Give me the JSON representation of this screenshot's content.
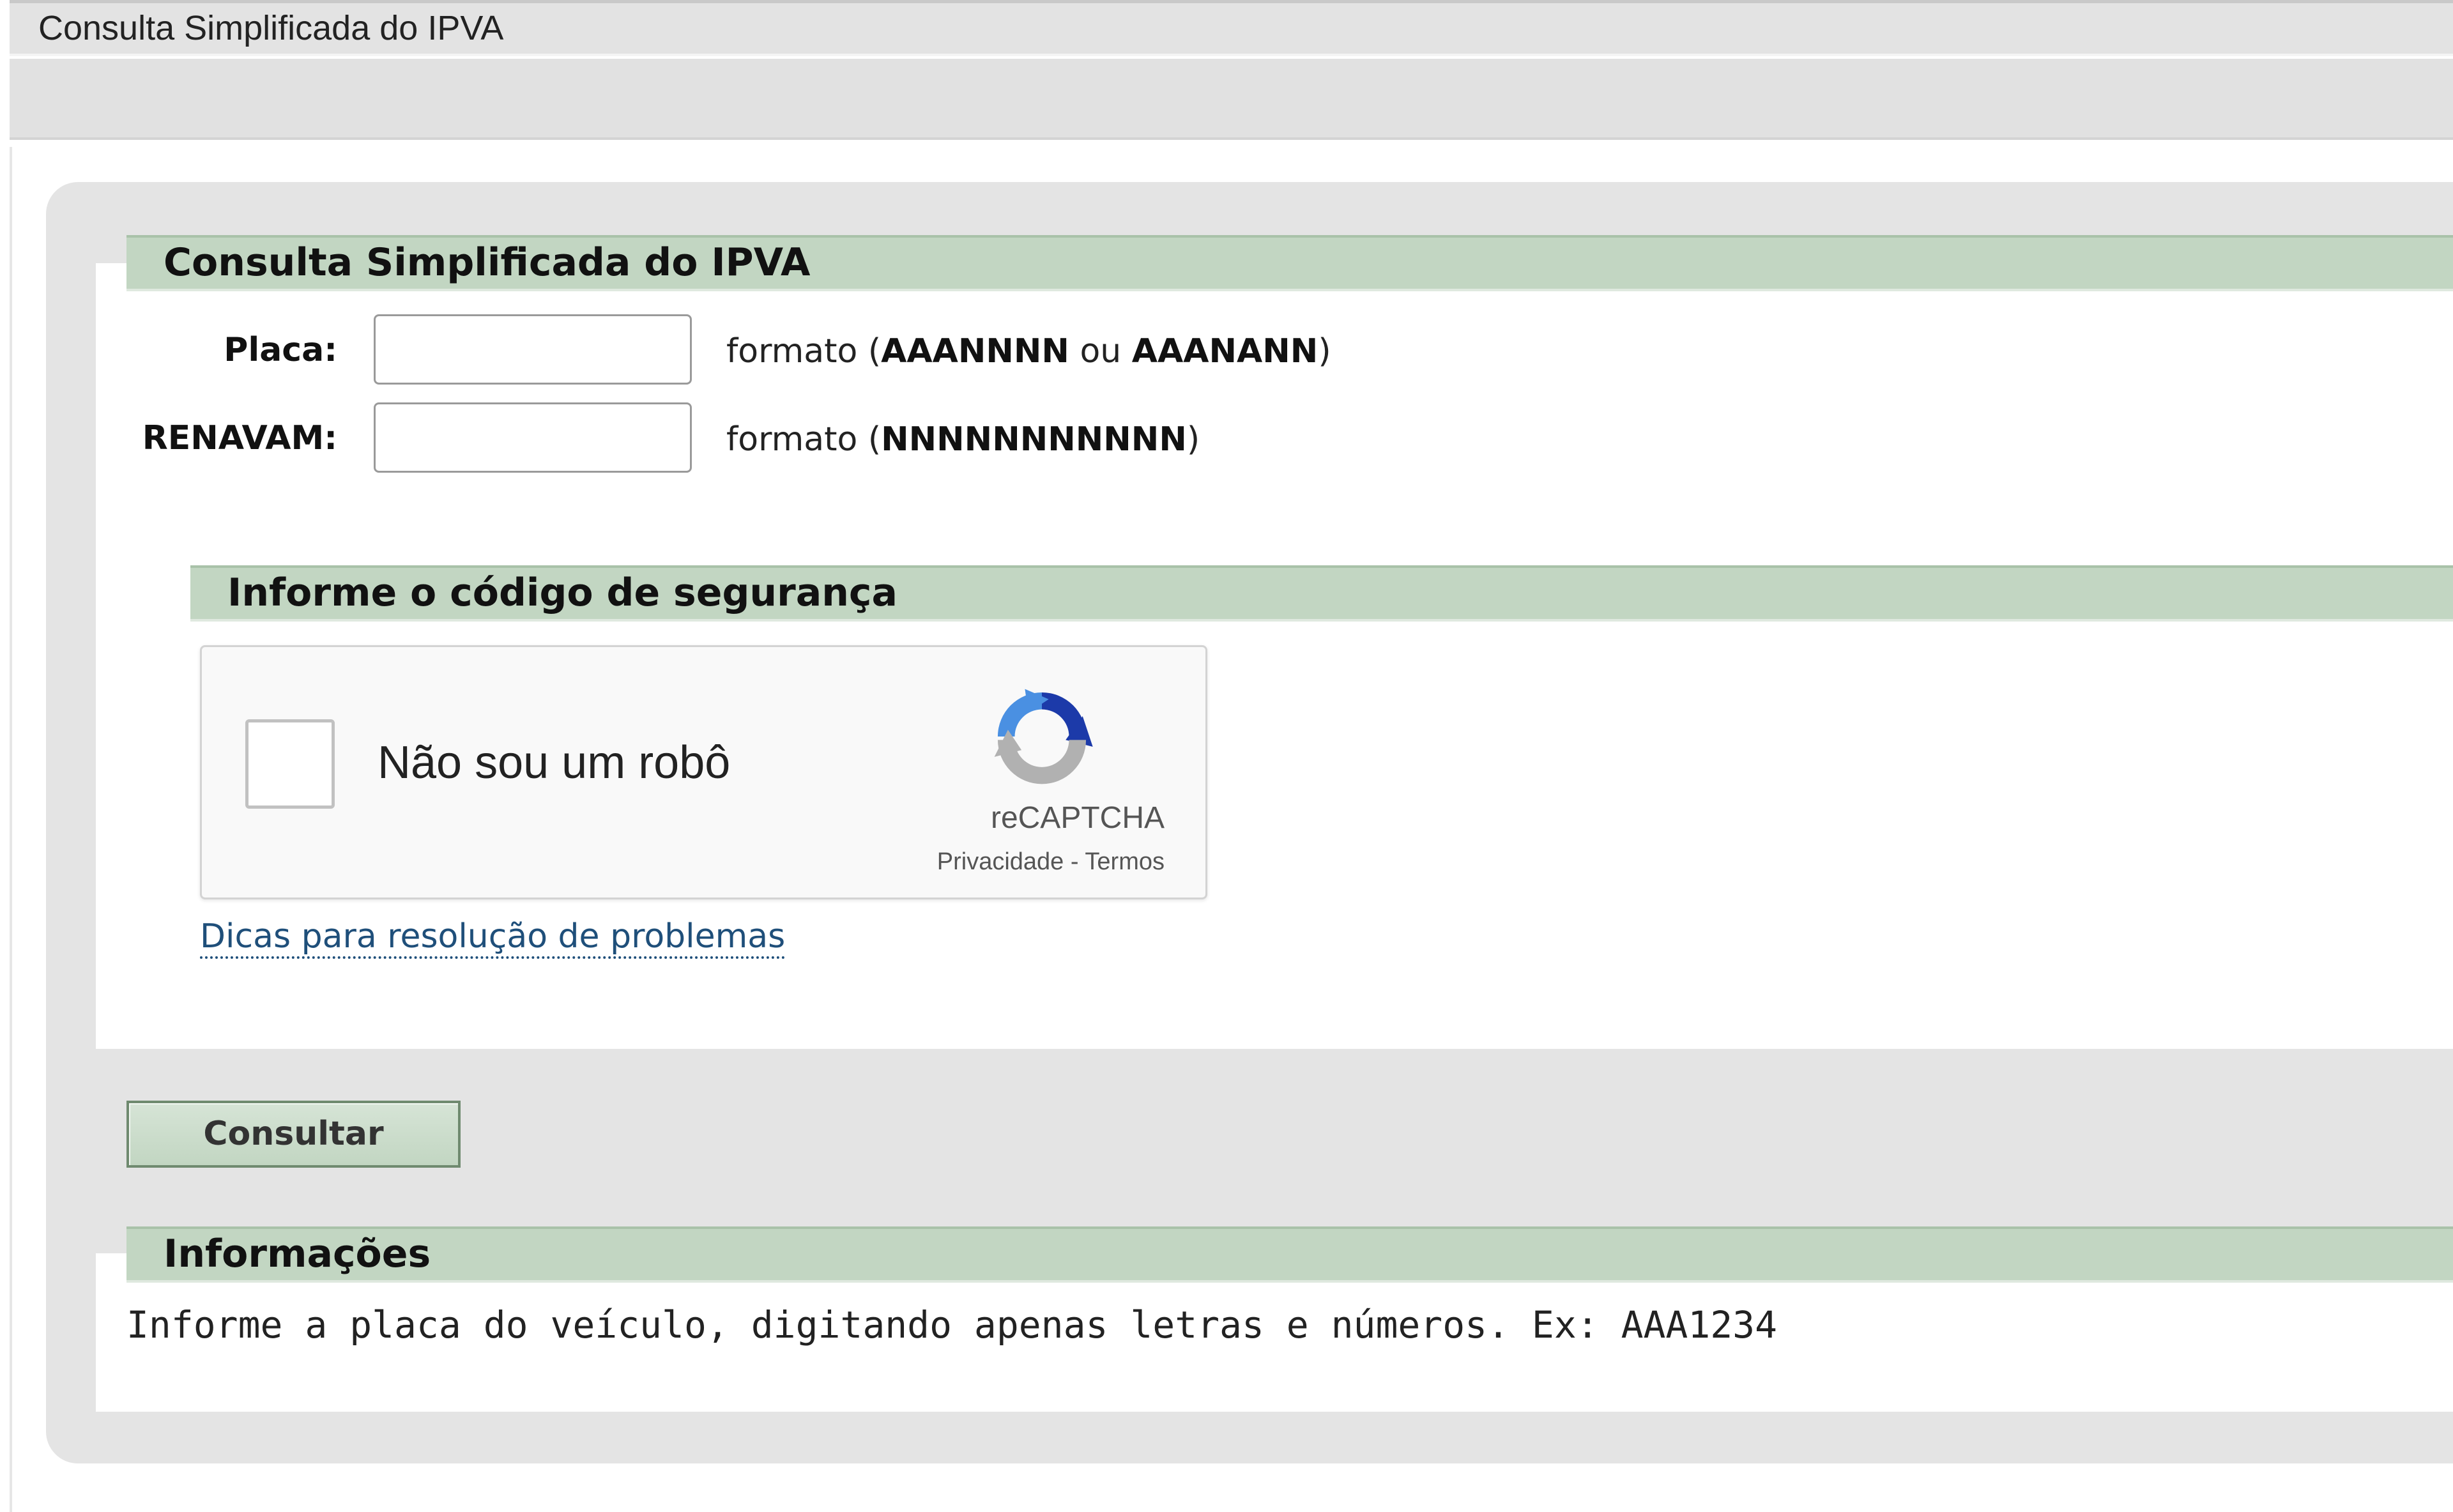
{
  "window": {
    "title": "Consulta Simplificada do IPVA"
  },
  "form": {
    "section_title": "Consulta Simplificada do IPVA",
    "placa": {
      "label": "Placa:",
      "value": "",
      "hint_prefix": "formato (",
      "hint_format_1": "AAANNNN",
      "hint_or": " ou ",
      "hint_format_2": "AAANANN",
      "hint_suffix": ")"
    },
    "renavam": {
      "label": "RENAVAM:",
      "value": "",
      "hint_prefix": "formato (",
      "hint_format": "NNNNNNNNNNN",
      "hint_suffix": ")"
    }
  },
  "security": {
    "section_title": "Informe o código de segurança",
    "recaptcha": {
      "checkbox_label": "Não sou um robô",
      "brand": "reCAPTCHA",
      "privacy": "Privacidade",
      "separator": " - ",
      "terms": "Termos",
      "checked": false,
      "logo_icon": "recaptcha-logo-icon"
    },
    "tips_link": "Dicas para resolução de problemas"
  },
  "actions": {
    "submit_label": "Consultar"
  },
  "info": {
    "section_title": "Informações",
    "text": "Informe a placa do veículo, digitando apenas letras e números. Ex: AAA1234"
  },
  "colors": {
    "section_header_bg": "#c2d6c2",
    "container_bg": "#e4e4e4",
    "link": "#1f4f7a",
    "recaptcha_blue": "#1c3aa9",
    "recaptcha_light_blue": "#4a90e2",
    "recaptcha_grey": "#b1b1b1"
  }
}
